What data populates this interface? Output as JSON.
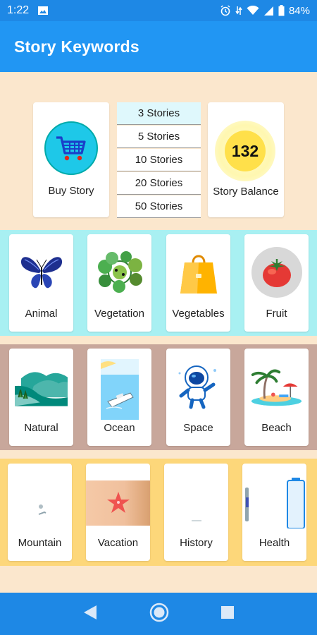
{
  "status_bar": {
    "time": "1:22",
    "battery": "84%",
    "icons": [
      "image-icon",
      "alarm-icon",
      "data-icon",
      "wifi-icon",
      "signal-icon",
      "battery-icon"
    ]
  },
  "app_bar": {
    "title": "Story Keywords"
  },
  "colors": {
    "status_bar": "#1e88e5",
    "app_bar": "#2196f3",
    "background": "#fbe7cd",
    "band_cyan": "#a8f0f2",
    "band_mauve": "#c8a79b",
    "band_yellow": "#fdd77a",
    "nav_bar": "#1e88e5"
  },
  "buy_card": {
    "label": "Buy Story",
    "icon": "cart-icon"
  },
  "story_options": [
    "3 Stories",
    "5 Stories",
    "10 Stories",
    "20 Stories",
    "50 Stories"
  ],
  "story_options_selected": "3 Stories",
  "balance_card": {
    "value": "132",
    "label": "Story Balance"
  },
  "keywords": {
    "row1": [
      {
        "label": "Animal",
        "icon": "butterfly-icon"
      },
      {
        "label": "Vegetation",
        "icon": "plants-icon"
      },
      {
        "label": "Vegetables",
        "icon": "shopping-bag-icon"
      },
      {
        "label": "Fruit",
        "icon": "tomato-icon"
      }
    ],
    "row2": [
      {
        "label": "Natural",
        "icon": "landscape-icon"
      },
      {
        "label": "Ocean",
        "icon": "ship-icon"
      },
      {
        "label": "Space",
        "icon": "astronaut-icon"
      },
      {
        "label": "Beach",
        "icon": "palm-tree-icon"
      }
    ],
    "row3": [
      {
        "label": "Mountain",
        "icon": "mountain-icon"
      },
      {
        "label": "Vacation",
        "icon": "starfish-icon"
      },
      {
        "label": "History",
        "icon": "history-icon"
      },
      {
        "label": "Health",
        "icon": "health-icon"
      }
    ]
  },
  "nav": {
    "icons": [
      "back-icon",
      "home-icon",
      "recents-icon"
    ]
  }
}
